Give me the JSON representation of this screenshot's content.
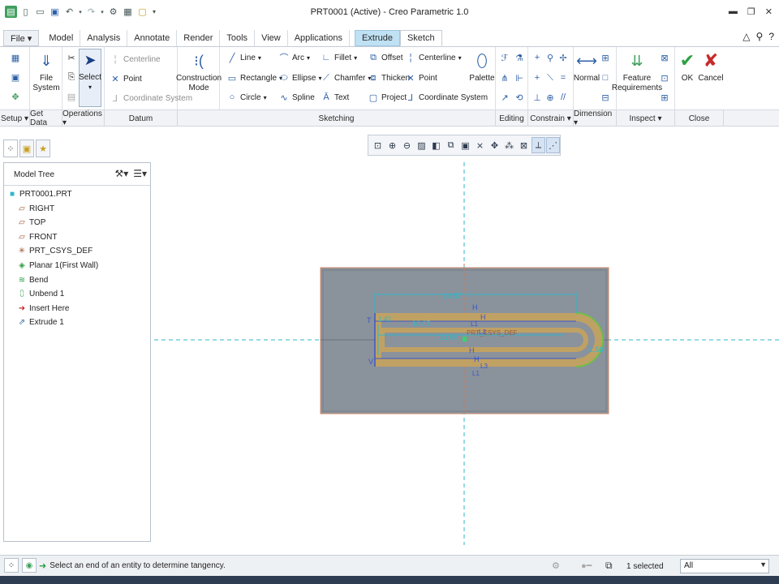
{
  "window": {
    "title": "PRT0001 (Active) - Creo Parametric 1.0"
  },
  "tabs": [
    "File ▾",
    "Model",
    "Analysis",
    "Annotate",
    "Render",
    "Tools",
    "View",
    "Applications",
    "Extrude",
    "Sketch"
  ],
  "ribbon": {
    "setup": {
      "file_system": "File System"
    },
    "operations": {
      "select": "Select"
    },
    "datum": {
      "centerline": "Centerline",
      "point": "Point",
      "coordinate_system": "Coordinate System"
    },
    "construction_mode": "Construction Mode",
    "sketching": {
      "line": "Line",
      "arc": "Arc",
      "fillet": "Fillet",
      "offset": "Offset",
      "centerline": "Centerline",
      "rectangle": "Rectangle",
      "ellipse": "Ellipse",
      "chamfer": "Chamfer",
      "thicken": "Thicken",
      "point": "Point",
      "circle": "Circle",
      "spline": "Spline",
      "text": "Text",
      "project": "Project",
      "coordinate_system": "Coordinate System",
      "palette": "Palette"
    },
    "dimension": {
      "normal": "Normal"
    },
    "inspect": {
      "feature_requirements": "Feature Requirements"
    },
    "close": {
      "ok": "OK",
      "cancel": "Cancel"
    }
  },
  "group_labels": [
    "Setup ▾",
    "Get Data",
    "Operations ▾",
    "Datum",
    "Sketching",
    "Editing",
    "Constrain ▾",
    "Dimension ▾",
    "Inspect ▾",
    "Close"
  ],
  "model_tree": {
    "title": "Model Tree",
    "items": [
      "PRT0001.PRT",
      "RIGHT",
      "TOP",
      "FRONT",
      "PRT_CSYS_DEF",
      "Planar 1(First Wall)",
      "Bend",
      "Unbend 1",
      "Insert Here",
      "Extrude 1"
    ]
  },
  "sketch": {
    "dim_top": "24.57",
    "dim_mid": "10.07",
    "dim_inner": "23.66",
    "dim_radius": "1.58",
    "dim_left": "1.40",
    "csys_label": "PRT_CSYS_DEF",
    "constraint_h": "H",
    "constraint_v": "V",
    "constraint_l1": "L1",
    "constraint_l3": "L3",
    "constraint_t": "T"
  },
  "status": {
    "message": "Select an end of an entity to determine tangency.",
    "selected": "1 selected",
    "filter": "All"
  },
  "colors": {
    "tab_extrude": "#bfe1f3",
    "sheet": "#8a929c",
    "slot_band": "#c9a35a",
    "sketch_blue": "#3a56c9",
    "datum_cyan": "#2fb7c9",
    "ok_green": "#2ea043",
    "cancel_red": "#c72b2b"
  }
}
